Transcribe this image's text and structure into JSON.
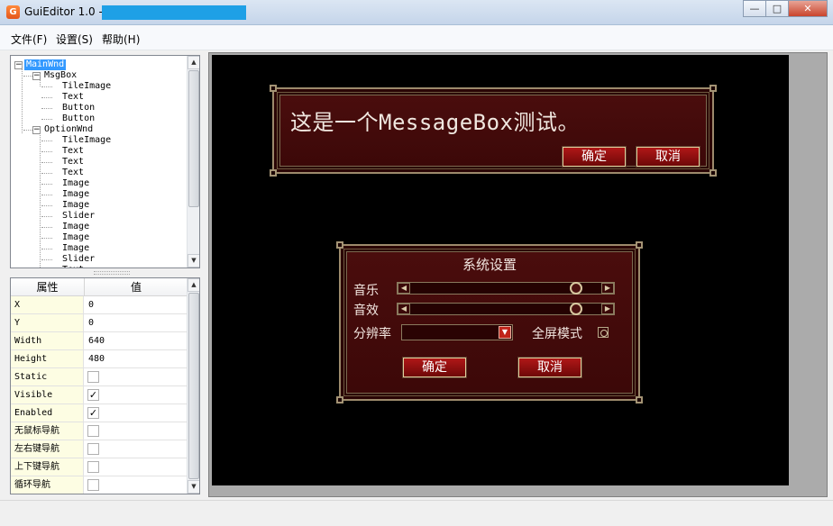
{
  "window": {
    "title": "GuiEditor 1.0 -",
    "app_icon_glyph": "G",
    "minimize_glyph": "—",
    "maximize_glyph": "□",
    "close_glyph": "✕",
    "title_highlight_color": "#1ea0e6"
  },
  "menu": {
    "items": [
      {
        "label": "文件(F)"
      },
      {
        "label": "设置(S)"
      },
      {
        "label": "帮助(H)"
      }
    ]
  },
  "tree": {
    "nodes": [
      {
        "label": "MainWnd",
        "level": 0,
        "expander": "−",
        "selected": true
      },
      {
        "label": "MsgBox",
        "level": 1,
        "expander": "−"
      },
      {
        "label": "TileImage",
        "level": 2
      },
      {
        "label": "Text",
        "level": 2
      },
      {
        "label": "Button",
        "level": 2
      },
      {
        "label": "Button",
        "level": 2
      },
      {
        "label": "OptionWnd",
        "level": 1,
        "expander": "−"
      },
      {
        "label": "TileImage",
        "level": 2
      },
      {
        "label": "Text",
        "level": 2
      },
      {
        "label": "Text",
        "level": 2
      },
      {
        "label": "Text",
        "level": 2
      },
      {
        "label": "Image",
        "level": 2
      },
      {
        "label": "Image",
        "level": 2
      },
      {
        "label": "Image",
        "level": 2
      },
      {
        "label": "Slider",
        "level": 2
      },
      {
        "label": "Image",
        "level": 2
      },
      {
        "label": "Image",
        "level": 2
      },
      {
        "label": "Image",
        "level": 2
      },
      {
        "label": "Slider",
        "level": 2
      },
      {
        "label": "Text",
        "level": 2
      }
    ]
  },
  "properties": {
    "header_name": "属性",
    "header_value": "值",
    "rows": [
      {
        "name": "X",
        "value": "0"
      },
      {
        "name": "Y",
        "value": "0"
      },
      {
        "name": "Width",
        "value": "640"
      },
      {
        "name": "Height",
        "value": "480"
      },
      {
        "name": "Static",
        "checkbox": true,
        "checked": false
      },
      {
        "name": "Visible",
        "checkbox": true,
        "checked": true
      },
      {
        "name": "Enabled",
        "checkbox": true,
        "checked": true
      },
      {
        "name": "无鼠标导航",
        "checkbox": true,
        "checked": false
      },
      {
        "name": "左右键导航",
        "checkbox": true,
        "checked": false
      },
      {
        "name": "上下键导航",
        "checkbox": true,
        "checked": false
      },
      {
        "name": "循环导航",
        "checkbox": true,
        "checked": false
      }
    ]
  },
  "msgbox": {
    "text": "这是一个MessageBox测试。",
    "ok_label": "确定",
    "cancel_label": "取消"
  },
  "option_wnd": {
    "title": "系统设置",
    "music_label": "音乐",
    "sound_label": "音效",
    "resolution_label": "分辨率",
    "fullscreen_label": "全屏模式",
    "music_level": 0.9,
    "sound_level": 0.9,
    "ok_label": "确定",
    "cancel_label": "取消"
  },
  "colors": {
    "canvas_bg": "#000000",
    "dialog_bg": "#3c0808",
    "button_bg": "#b01717",
    "frame_gold": "#9c8a6c"
  }
}
